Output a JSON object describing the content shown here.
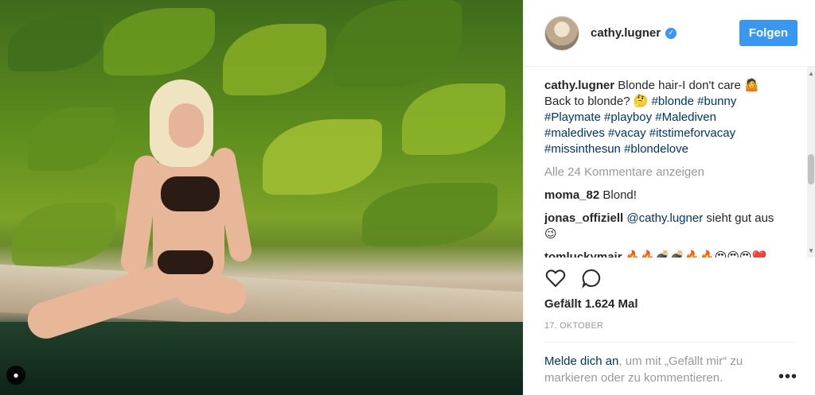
{
  "post": {
    "username": "cathy.lugner",
    "follow_label": "Folgen",
    "caption": {
      "user": "cathy.lugner",
      "line1": " Blonde hair-I don't care 🤷",
      "line2_prefix": "Back to blonde? 🤔 ",
      "hashtags_line2": [
        "#blonde",
        "#bunny"
      ],
      "hashtags_line3": [
        "#Playmate",
        "#playboy",
        "#Malediven"
      ],
      "hashtags_line4": [
        "#maledives",
        "#vacay",
        "#itstimeforvacay"
      ],
      "hashtags_line5": [
        "#missinthesun",
        "#blondelove"
      ]
    },
    "more_comments": "Alle 24 Kommentare anzeigen",
    "comments": [
      {
        "user": "moma_82",
        "text": " Blond!"
      },
      {
        "user": "jonas_offiziell",
        "mention": "@cathy.lugner",
        "text": " sieht gut aus",
        "extra": "😉"
      },
      {
        "user": "tomluckymair",
        "text": " 🔥🔥💣💣🔥🔥😍😍😍❤️"
      }
    ],
    "likes": "Gefällt 1.624 Mal",
    "date": "17. OKTOBER",
    "login_link": "Melde dich an",
    "login_text": ", um mit „Gefällt mir“ zu markieren oder zu kommentieren.",
    "icons": {
      "like": "heart-outline-icon",
      "comment": "comment-bubble-icon",
      "more": "more-ellipsis-icon",
      "verified": "verified-badge-icon",
      "photo_owner": "photo-user-tag-icon"
    },
    "colors": {
      "accent": "#3897f0",
      "link": "#003569",
      "muted": "#999999"
    }
  }
}
